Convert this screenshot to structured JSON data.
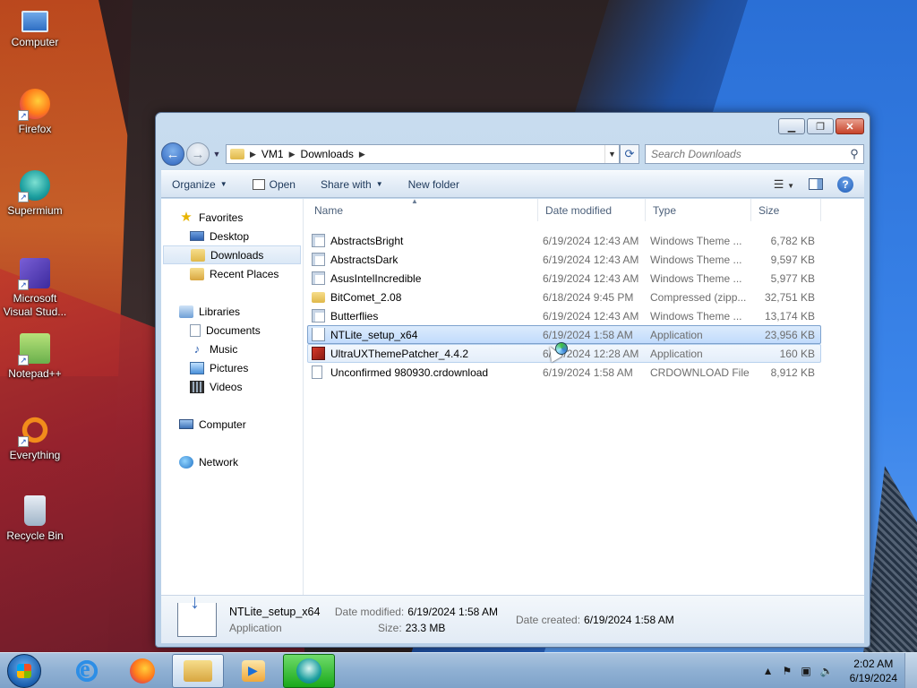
{
  "desktop": {
    "icons": [
      {
        "label": "Computer",
        "icon": "computer-icon"
      },
      {
        "label": "Firefox",
        "icon": "firefox-icon"
      },
      {
        "label": "Supermium",
        "icon": "supermium-icon"
      },
      {
        "label": "Microsoft Visual Stud...",
        "icon": "visual-studio-icon"
      },
      {
        "label": "Notepad++",
        "icon": "notepadplusplus-icon"
      },
      {
        "label": "Everything",
        "icon": "everything-icon"
      },
      {
        "label": "Recycle Bin",
        "icon": "recycle-bin-icon"
      }
    ]
  },
  "window": {
    "address": {
      "crumbs": [
        "VM1",
        "Downloads"
      ]
    },
    "search": {
      "placeholder": "Search Downloads"
    },
    "commandbar": {
      "organize": "Organize",
      "open": "Open",
      "share_with": "Share with",
      "new_folder": "New folder"
    },
    "navpane": {
      "favorites": "Favorites",
      "desktop": "Desktop",
      "downloads": "Downloads",
      "recent_places": "Recent Places",
      "libraries": "Libraries",
      "documents": "Documents",
      "music": "Music",
      "pictures": "Pictures",
      "videos": "Videos",
      "computer": "Computer",
      "network": "Network"
    },
    "columns": {
      "name": "Name",
      "date": "Date modified",
      "type": "Type",
      "size": "Size"
    },
    "files": [
      {
        "name": "AbstractsBright",
        "date": "6/19/2024 12:43 AM",
        "type": "Windows Theme ...",
        "size": "6,782 KB",
        "icon": "theme-file-icon"
      },
      {
        "name": "AbstractsDark",
        "date": "6/19/2024 12:43 AM",
        "type": "Windows Theme ...",
        "size": "9,597 KB",
        "icon": "theme-file-icon"
      },
      {
        "name": "AsusIntelIncredible",
        "date": "6/19/2024 12:43 AM",
        "type": "Windows Theme ...",
        "size": "5,977 KB",
        "icon": "theme-file-icon"
      },
      {
        "name": "BitComet_2.08",
        "date": "6/18/2024 9:45 PM",
        "type": "Compressed (zipp...",
        "size": "32,751 KB",
        "icon": "zip-folder-icon"
      },
      {
        "name": "Butterflies",
        "date": "6/19/2024 12:43 AM",
        "type": "Windows Theme ...",
        "size": "13,174 KB",
        "icon": "theme-file-icon"
      },
      {
        "name": "NTLite_setup_x64",
        "date": "6/19/2024 1:58 AM",
        "type": "Application",
        "size": "23,956 KB",
        "icon": "setup-icon"
      },
      {
        "name": "UltraUXThemePatcher_4.4.2",
        "date": "6/19/2024 12:28 AM",
        "type": "Application",
        "size": "160 KB",
        "icon": "patcher-icon"
      },
      {
        "name": "Unconfirmed 980930.crdownload",
        "date": "6/19/2024 1:58 AM",
        "type": "CRDOWNLOAD File",
        "size": "8,912 KB",
        "icon": "document-icon"
      }
    ],
    "details": {
      "name": "NTLite_setup_x64",
      "kind": "Application",
      "date_modified_label": "Date modified:",
      "date_modified": "6/19/2024 1:58 AM",
      "size_label": "Size:",
      "size": "23.3 MB",
      "date_created_label": "Date created:",
      "date_created": "6/19/2024 1:58 AM"
    }
  },
  "taskbar": {
    "clock_time": "2:02 AM",
    "clock_date": "6/19/2024"
  }
}
